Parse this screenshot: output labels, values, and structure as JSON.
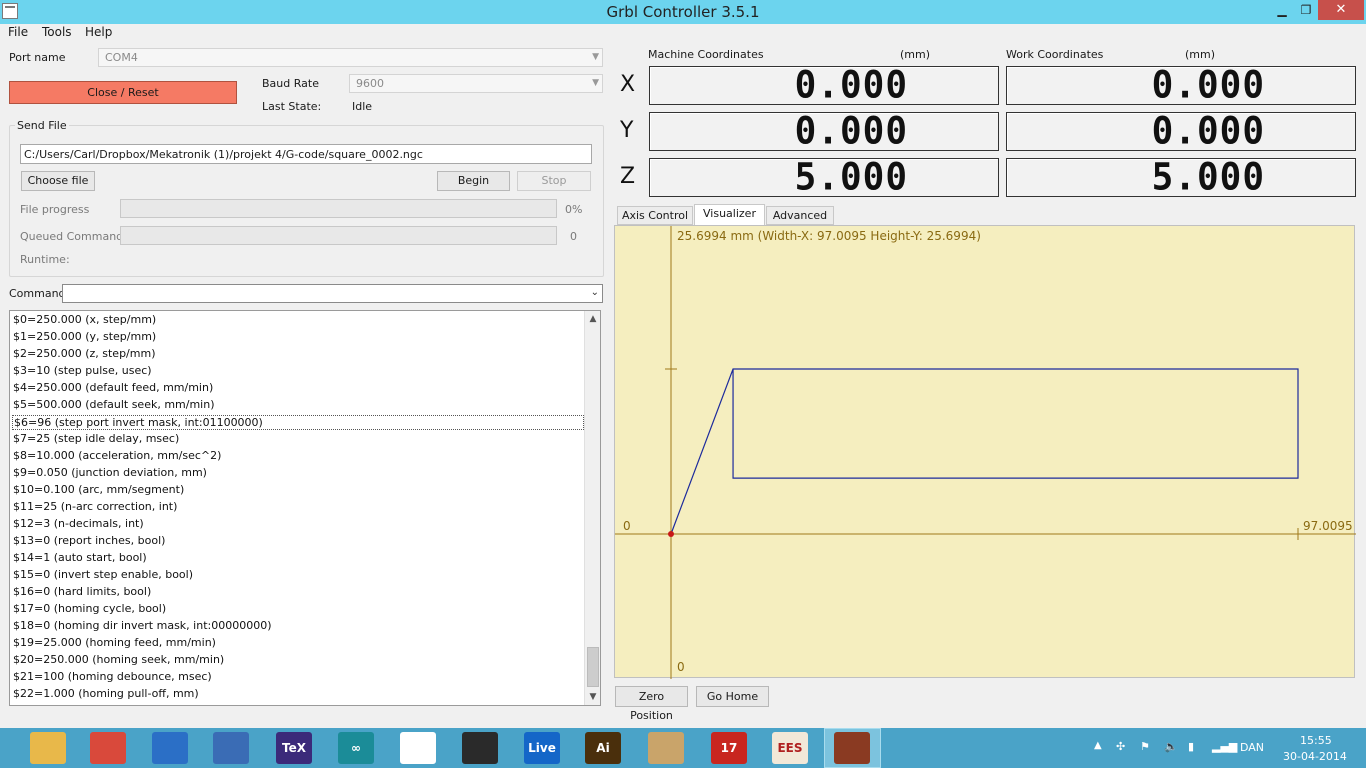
{
  "window": {
    "title": "Grbl Controller 3.5.1",
    "min_glyph": "▁",
    "max_glyph": "❐",
    "close_glyph": "✕"
  },
  "menu": {
    "items": [
      "File",
      "Tools",
      "Help"
    ]
  },
  "connection": {
    "port_label": "Port name",
    "port_value": "COM4",
    "close_reset_label": "Close / Reset",
    "baud_label": "Baud Rate",
    "baud_value": "9600",
    "last_state_label": "Last State:",
    "last_state_value": "Idle"
  },
  "send_file": {
    "group_title": "Send File",
    "path": "C:/Users/Carl/Dropbox/Mekatronik (1)/projekt 4/G-code/square_0002.ngc",
    "choose_label": "Choose file",
    "begin_label": "Begin",
    "stop_label": "Stop",
    "file_progress_label": "File progress",
    "file_progress_value": "0%",
    "queued_label": "Queued Commands",
    "queued_value": "0",
    "runtime_label": "Runtime:"
  },
  "command": {
    "label": "Command",
    "value": ""
  },
  "console": {
    "selected_index": 6,
    "lines": [
      "$0=250.000 (x, step/mm)",
      "$1=250.000 (y, step/mm)",
      "$2=250.000 (z, step/mm)",
      "$3=10 (step pulse, usec)",
      "$4=250.000 (default feed, mm/min)",
      "$5=500.000 (default seek, mm/min)",
      "$6=96 (step port invert mask, int:01100000)",
      "$7=25 (step idle delay, msec)",
      "$8=10.000 (acceleration, mm/sec^2)",
      "$9=0.050 (junction deviation, mm)",
      "$10=0.100 (arc, mm/segment)",
      "$11=25 (n-arc correction, int)",
      "$12=3 (n-decimals, int)",
      "$13=0 (report inches, bool)",
      "$14=1 (auto start, bool)",
      "$15=0 (invert step enable, bool)",
      "$16=0 (hard limits, bool)",
      "$17=0 (homing cycle, bool)",
      "$18=0 (homing dir invert mask, int:00000000)",
      "$19=25.000 (homing feed, mm/min)",
      "$20=250.000 (homing seek, mm/min)",
      "$21=100 (homing debounce, msec)",
      "$22=1.000 (homing pull-off, mm)"
    ]
  },
  "coordinates": {
    "machine_title": "Machine Coordinates",
    "work_title": "Work Coordinates",
    "unit": "(mm)",
    "axes": [
      {
        "axis": "X",
        "machine": "0.000",
        "work": "0.000"
      },
      {
        "axis": "Y",
        "machine": "0.000",
        "work": "0.000"
      },
      {
        "axis": "Z",
        "machine": "5.000",
        "work": "5.000"
      }
    ]
  },
  "tabs": {
    "items": [
      "Axis Control",
      "Visualizer",
      "Advanced"
    ],
    "active": "Visualizer"
  },
  "visualizer": {
    "header": "25.6994 mm  (Width-X: 97.0095  Height-Y: 25.6994)",
    "x_min_label": "0",
    "x_max_label": "97.0095",
    "y_min_label": "0",
    "width_x": 97.0095,
    "height_y": 25.6994,
    "path_color": "#1c2a9c",
    "axis_color": "#a07818",
    "origin_color": "#c81818"
  },
  "buttons": {
    "zero_position": "Zero Position",
    "go_home": "Go Home"
  },
  "taskbar": {
    "apps": [
      {
        "name": "file-explorer-icon",
        "label": "",
        "color": "#e8b84a"
      },
      {
        "name": "chrome-icon",
        "label": "",
        "color": "#d9493b"
      },
      {
        "name": "itunes-icon",
        "label": "",
        "color": "#2b6fc6"
      },
      {
        "name": "thunderbird-icon",
        "label": "",
        "color": "#3a6cb5"
      },
      {
        "name": "texmaker-icon",
        "label": "TeX",
        "color": "#3b2a7a"
      },
      {
        "name": "arduino-icon",
        "label": "∞",
        "color": "#1b8c98"
      },
      {
        "name": "start-screen-icon",
        "label": "",
        "color": "#ffffff"
      },
      {
        "name": "steam-icon",
        "label": "",
        "color": "#2a2a2a"
      },
      {
        "name": "live-icon",
        "label": "Live",
        "color": "#1466c8"
      },
      {
        "name": "illustrator-icon",
        "label": "Ai",
        "color": "#4a2f0c"
      },
      {
        "name": "paint-icon",
        "label": "",
        "color": "#c9a46a"
      },
      {
        "name": "autodesk-icon",
        "label": "17",
        "color": "#c8261f"
      },
      {
        "name": "ees-icon",
        "label": "EES",
        "color": "#f2e8d8"
      },
      {
        "name": "grbl-controller-icon",
        "label": "",
        "color": "#8a3a22"
      }
    ],
    "language": "DAN",
    "time": "15:55",
    "date": "30-04-2014"
  }
}
